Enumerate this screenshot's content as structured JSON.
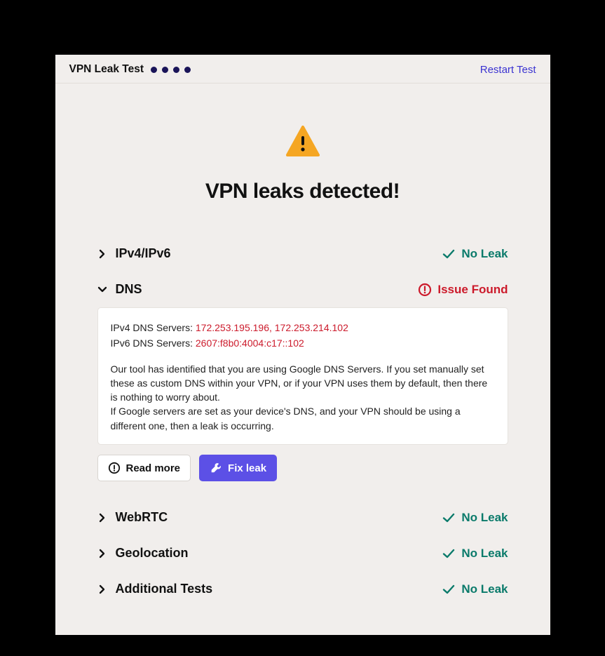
{
  "header": {
    "title": "VPN Leak Test",
    "restart_label": "Restart Test"
  },
  "hero": {
    "title": "VPN leaks detected!"
  },
  "status": {
    "no_leak": "No Leak",
    "issue_found": "Issue Found"
  },
  "tests": {
    "ipv": {
      "label": "IPv4/IPv6"
    },
    "dns": {
      "label": "DNS"
    },
    "webrtc": {
      "label": "WebRTC"
    },
    "geo": {
      "label": "Geolocation"
    },
    "additional": {
      "label": "Additional Tests"
    }
  },
  "dns_details": {
    "ipv4_label": "IPv4 DNS Servers: ",
    "ipv4_value": "172.253.195.196, 172.253.214.102",
    "ipv6_label": "IPv6 DNS Servers: ",
    "ipv6_value": "2607:f8b0:4004:c17::102",
    "explain1": "Our tool has identified that you are using Google DNS Servers. If you set manually set these as custom DNS within your VPN, or if your VPN uses them by default, then there is nothing to worry about.",
    "explain2": "If Google servers are set as your device's DNS, and your VPN should be using a different one, then a leak is occurring."
  },
  "actions": {
    "read_more": "Read more",
    "fix_leak": "Fix leak"
  }
}
